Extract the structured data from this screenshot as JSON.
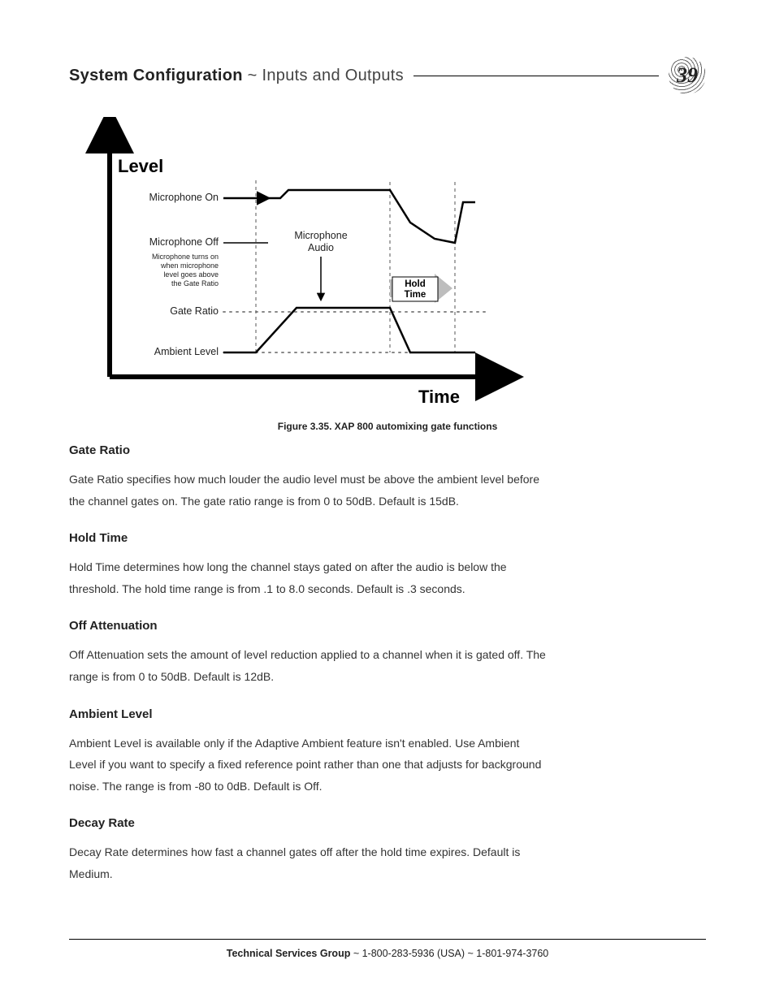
{
  "header": {
    "title_strong": "System Configuration",
    "title_sep": " ~ ",
    "title_light": "Inputs and Outputs",
    "page_number": "39"
  },
  "figure": {
    "axis_y": "Level",
    "axis_x": "Time",
    "labels": {
      "mic_on": "Microphone On",
      "mic_off": "Microphone Off",
      "note_line1": "Microphone turns on",
      "note_line2": "when microphone",
      "note_line3": "level goes above",
      "note_line4": "the Gate Ratio",
      "gate_ratio": "Gate Ratio",
      "ambient": "Ambient Level",
      "mic_audio1": "Microphone",
      "mic_audio2": "Audio",
      "hold1": "Hold",
      "hold2": "Time"
    },
    "caption": "Figure 3.35. XAP 800 automixing gate functions"
  },
  "sections": [
    {
      "heading": "Gate Ratio",
      "body": "Gate Ratio specifies how much louder the audio level must be above the ambient level before the channel gates on. The gate ratio range is from 0 to 50dB. Default is 15dB."
    },
    {
      "heading": "Hold Time",
      "body": "Hold Time determines how long the channel stays gated on after the audio is below the threshold. The hold time range is from .1 to 8.0 seconds. Default is .3 seconds."
    },
    {
      "heading": "Off Attenuation",
      "body": "Off Attenuation sets the amount of level reduction applied to a channel when it is gated off. The range is from 0 to 50dB. Default is 12dB."
    },
    {
      "heading": "Ambient Level",
      "body": "Ambient Level is available only if the Adaptive Ambient feature isn't enabled. Use Ambient Level if you want to specify a fixed reference point rather than one that adjusts for background noise. The range is from -80 to 0dB. Default is Off."
    },
    {
      "heading": "Decay Rate",
      "body": "Decay Rate determines how fast a channel gates off after the hold time expires. Default is Medium."
    }
  ],
  "footer": {
    "strong": "Technical Services Group",
    "rest": " ~ 1-800-283-5936 (USA) ~ 1-801-974-3760"
  },
  "chart_data": {
    "type": "diagram",
    "description": "Qualitative step diagram along axes Level (y) vs Time (x) showing a microphone audio envelope gating on above the Gate Ratio, staying above Ambient Level, then decaying after a Hold Time interval. Labeled dotted thresholds at Gate Ratio and Ambient Level.",
    "x_axis": "Time",
    "y_axis": "Level",
    "named_levels": [
      "Microphone On",
      "Microphone Off",
      "Gate Ratio",
      "Ambient Level"
    ],
    "callouts": [
      "Microphone Audio",
      "Hold Time",
      "Microphone turns on when microphone level goes above the Gate Ratio"
    ]
  }
}
